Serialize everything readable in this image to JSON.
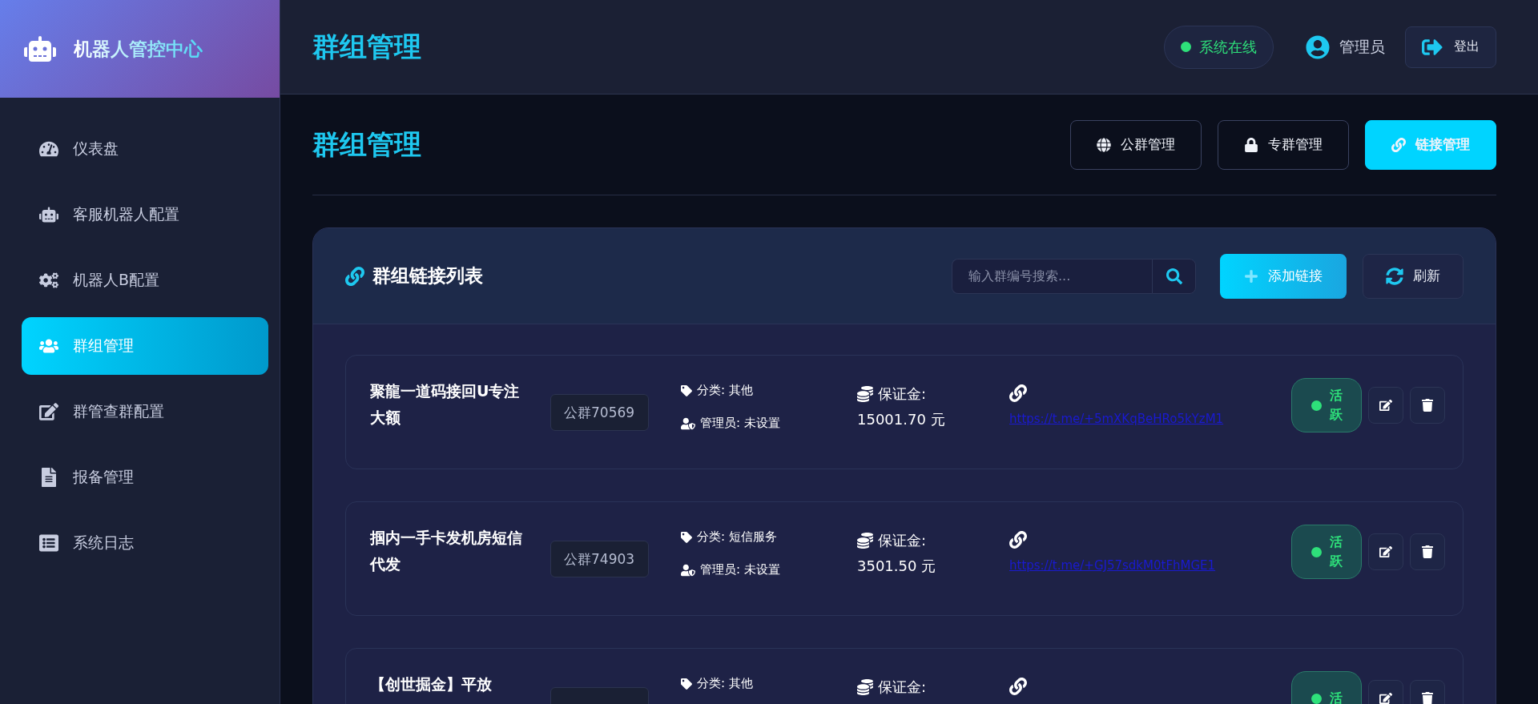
{
  "brand": {
    "title": "机器人管控中心"
  },
  "sidebar": {
    "items": [
      {
        "label": "仪表盘",
        "selected": false
      },
      {
        "label": "客服机器人配置",
        "selected": false
      },
      {
        "label": "机器人B配置",
        "selected": false
      },
      {
        "label": "群组管理",
        "selected": true
      },
      {
        "label": "群管查群配置",
        "selected": false
      },
      {
        "label": "报备管理",
        "selected": false
      },
      {
        "label": "系统日志",
        "selected": false
      }
    ]
  },
  "topbar": {
    "title": "群组管理",
    "status": "系统在线",
    "user": "管理员",
    "logout": "登出"
  },
  "page": {
    "title": "群组管理",
    "tabs": [
      {
        "label": "公群管理",
        "selected": false
      },
      {
        "label": "专群管理",
        "selected": false
      },
      {
        "label": "链接管理",
        "selected": true
      }
    ]
  },
  "panel": {
    "title": "群组链接列表",
    "search": {
      "placeholder": "输入群编号搜索..."
    },
    "add_button": "添加链接",
    "refresh_button": "刷新",
    "groups": [
      {
        "name": "聚龍一道码接回U专注大额",
        "badge": "公群70569",
        "category": "分类: 其他",
        "admin": "管理员: 未设置",
        "deposit_label": "保证金:",
        "deposit": "15001.70 元",
        "link": "https://t.me/+5mXKqBeHRo5kYzM1",
        "status": {
          "text": "活跃",
          "active": true
        }
      },
      {
        "name": "掴内一手卡发机房短信代发",
        "badge": "公群74903",
        "category": "分类: 短信服务",
        "admin": "管理员: 未设置",
        "deposit_label": "保证金:",
        "deposit": "3501.50 元",
        "link": "https://t.me/+GJ57sdkM0tFhMGE1",
        "status": {
          "text": "活跃",
          "active": true
        }
      },
      {
        "name": "【创世掘金】平放",
        "category": "分类: 其他",
        "deposit_label": "保证金:",
        "link_icon": true,
        "status": {
          "text": "活",
          "active": true
        }
      }
    ]
  }
}
